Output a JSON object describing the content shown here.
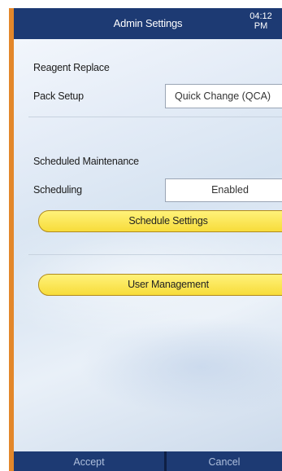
{
  "header": {
    "title": "Admin Settings",
    "time": "04:12",
    "ampm": "PM"
  },
  "reagent": {
    "section_label": "Reagent Replace",
    "pack_label": "Pack Setup",
    "pack_value": "Quick Change (QCA)"
  },
  "maintenance": {
    "section_label": "Scheduled Maintenance",
    "scheduling_label": "Scheduling",
    "scheduling_value": "Enabled",
    "schedule_button": "Schedule Settings"
  },
  "user_management_button": "User Management",
  "footer": {
    "accept": "Accept",
    "cancel": "Cancel"
  },
  "colors": {
    "bar": "#1d3a73",
    "bezel": "#e3872a",
    "button": "#f7dc3a"
  }
}
